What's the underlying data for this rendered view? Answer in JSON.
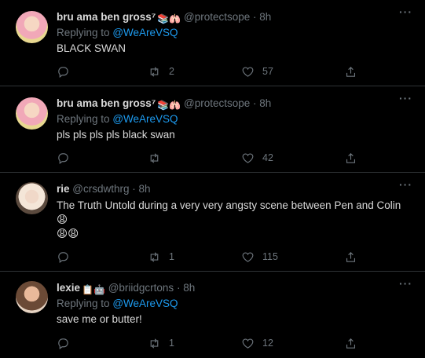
{
  "tweets": [
    {
      "name": "bru ama ben gross⁷",
      "handle": "@protectsope",
      "time": "8h",
      "replying_label": "Replying to",
      "replying_to": "@WeAreVSQ",
      "text": "BLACK SWAN",
      "replies": "",
      "retweets": "2",
      "likes": "57"
    },
    {
      "name": "bru ama ben gross⁷",
      "handle": "@protectsope",
      "time": "8h",
      "replying_label": "Replying to",
      "replying_to": "@WeAreVSQ",
      "text": "pls pls pls pls black swan",
      "replies": "",
      "retweets": "",
      "likes": "42"
    },
    {
      "name": "rie",
      "handle": "@crsdwthrg",
      "time": "8h",
      "text": "The Truth Untold during a very very angsty scene between Pen and Colin 😩",
      "text2": "😩😩",
      "replies": "",
      "retweets": "1",
      "likes": "115"
    },
    {
      "name": "lexie",
      "handle": "@briidgcrtons",
      "time": "8h",
      "replying_label": "Replying to",
      "replying_to": "@WeAreVSQ",
      "text": "save me or butter!",
      "replies": "",
      "retweets": "1",
      "likes": "12"
    }
  ],
  "separator": "·",
  "more_glyph": "···",
  "emoji_set_1": "📚🫁",
  "emoji_set_2": "📋🤖"
}
